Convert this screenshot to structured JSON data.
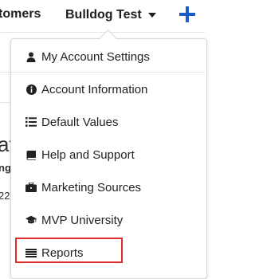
{
  "topbar": {
    "nav_partial": "tomers",
    "account_name": "Bulldog Test"
  },
  "background": {
    "big_text": "at",
    "small_text": "ng",
    "number_text": "22"
  },
  "menu": {
    "items": [
      {
        "label": "My Account Settings",
        "icon": "user-icon"
      },
      {
        "label": "Account Information",
        "icon": "info-circle-icon"
      },
      {
        "label": "Default Values",
        "icon": "list-icon"
      },
      {
        "label": "Help and Support",
        "icon": "book-icon"
      },
      {
        "label": "Marketing Sources",
        "icon": "briefcase-icon"
      },
      {
        "label": "MVP University",
        "icon": "graduation-cap-icon"
      },
      {
        "label": "Reports",
        "icon": "bars-icon"
      }
    ]
  },
  "colors": {
    "accent": "#1a5bc4",
    "highlight": "#e02b2b"
  }
}
